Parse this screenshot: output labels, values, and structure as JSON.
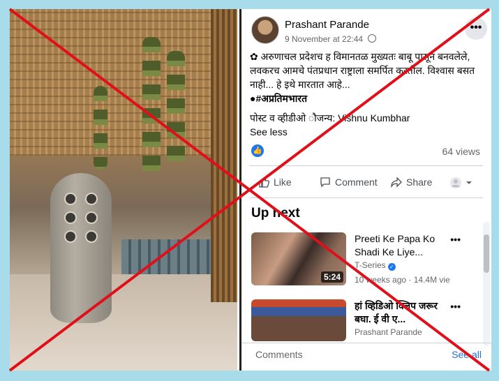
{
  "post": {
    "author": "Prashant Parande",
    "timestamp": "9 November at 22:44",
    "text_line1": "अरुणाचल प्रदेशच ह विमानतळ मुख्यतः बाबू पासून बनवलेले, लवकरच आमचे पंतप्रधान राष्ट्राला समर्पित करतील. विश्वास बसत नाही... हे इथे मारतात आहे...",
    "hashtag": "●#अप्रतिमभारत",
    "credit": "पोस्ट व व्हीडीओ ौजन्य: Vishnu Kumbhar",
    "see_less": "See less",
    "views": "64 views",
    "more_icon": "•••"
  },
  "actions": {
    "like": "Like",
    "comment": "Comment",
    "share": "Share"
  },
  "upnext": {
    "heading": "Up next",
    "items": [
      {
        "title": "Preeti Ke Papa Ko Shadi Ke Liye...",
        "channel": "T-Series",
        "info": "10 weeks ago · 14.4M vie",
        "duration": "5:24"
      },
      {
        "title": "हां व्हिडिओ क्लिप जरूर बघा. ई वी ए...",
        "channel": "Prashant Parande",
        "info": "",
        "duration": ""
      }
    ]
  },
  "footer": {
    "comments": "Comments",
    "see_all": "See all"
  },
  "colors": {
    "cross": "#e0101a",
    "frame_bg": "#a8dcea",
    "link": "#216fdb"
  }
}
